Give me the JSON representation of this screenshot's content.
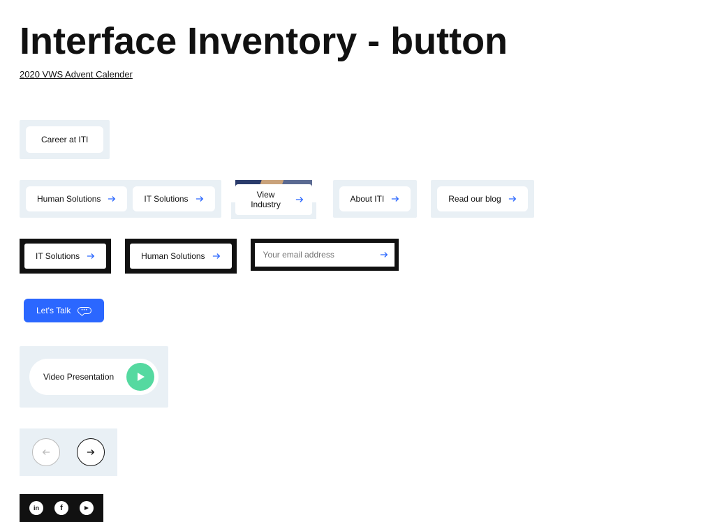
{
  "title": "Interface Inventory - button",
  "subtitle": "2020 VWS Advent Calender",
  "row1": {
    "career": "Career at ITI"
  },
  "row2": {
    "human": "Human Solutions",
    "it": "IT Solutions",
    "view_industry": "View Industry",
    "about": "About ITI",
    "blog": "Read our blog"
  },
  "row3": {
    "it": "IT Solutions",
    "human": "Human Solutions",
    "email_placeholder": "Your email address"
  },
  "lets_talk": "Let's Talk",
  "video": "Video Presentation",
  "social": {
    "linkedin": "in",
    "facebook": "f",
    "youtube": "▶"
  }
}
